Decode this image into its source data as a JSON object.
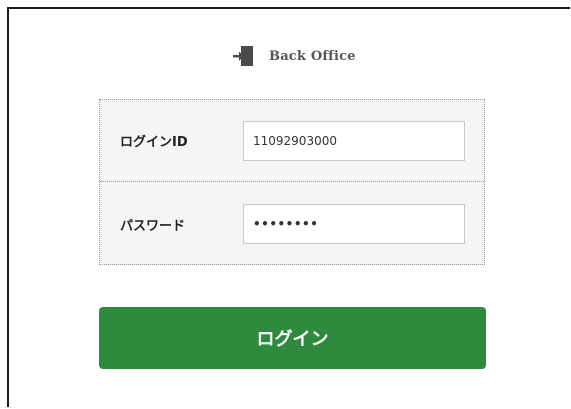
{
  "header": {
    "brand": "Back Office",
    "icon": "door-exit-icon",
    "icon_color": "#4a4a4a"
  },
  "form": {
    "login_id": {
      "label": "ログインID",
      "value": "11092903000"
    },
    "password": {
      "label": "パスワード",
      "value": "••••••••"
    }
  },
  "actions": {
    "login_label": "ログイン",
    "login_color": "#2e8b3d"
  }
}
